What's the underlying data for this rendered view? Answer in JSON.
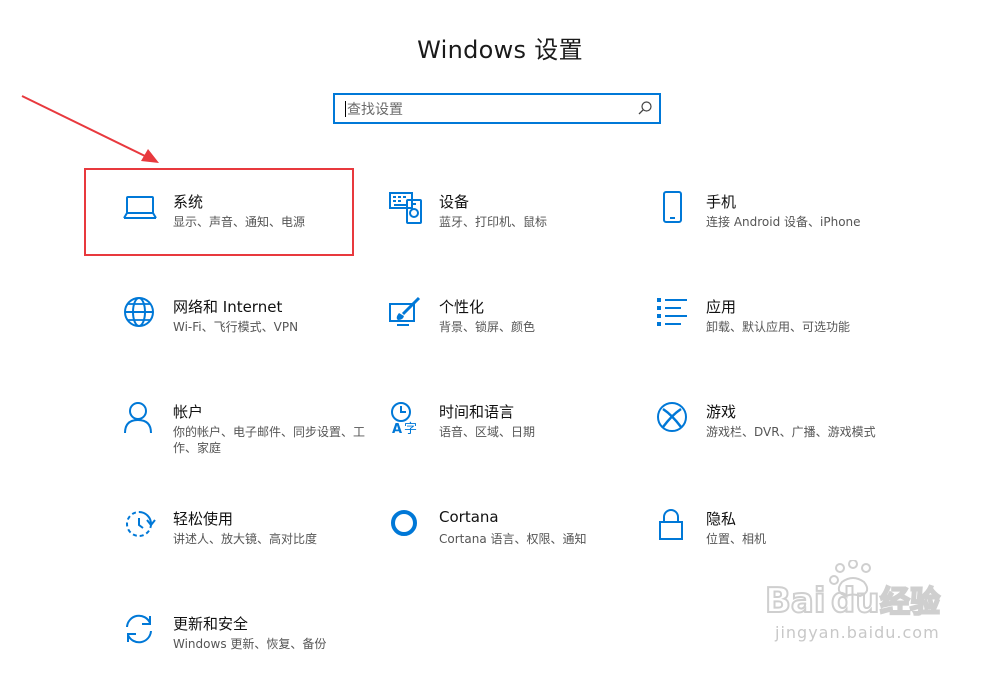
{
  "window": {
    "title": "Windows 设置"
  },
  "search": {
    "placeholder": "查找设置"
  },
  "accent_color": "#0078d7",
  "highlight_color": "#e8393e",
  "tiles": [
    {
      "name": "系统",
      "desc": "显示、声音、通知、电源",
      "icon": "laptop-icon"
    },
    {
      "name": "设备",
      "desc": "蓝牙、打印机、鼠标",
      "icon": "keyboard-devices-icon"
    },
    {
      "name": "手机",
      "desc": "连接 Android 设备、iPhone",
      "icon": "phone-icon"
    },
    {
      "name": "网络和 Internet",
      "desc": "Wi-Fi、飞行模式、VPN",
      "icon": "globe-icon"
    },
    {
      "name": "个性化",
      "desc": "背景、锁屏、颜色",
      "icon": "paint-brush-icon"
    },
    {
      "name": "应用",
      "desc": "卸载、默认应用、可选功能",
      "icon": "apps-list-icon"
    },
    {
      "name": "帐户",
      "desc": "你的帐户、电子邮件、同步设置、工作、家庭",
      "icon": "person-icon"
    },
    {
      "name": "时间和语言",
      "desc": "语音、区域、日期",
      "icon": "time-language-icon"
    },
    {
      "name": "游戏",
      "desc": "游戏栏、DVR、广播、游戏模式",
      "icon": "xbox-icon"
    },
    {
      "name": "轻松使用",
      "desc": "讲述人、放大镜、高对比度",
      "icon": "ease-of-access-icon"
    },
    {
      "name": "Cortana",
      "desc": "Cortana 语言、权限、通知",
      "icon": "cortana-ring-icon"
    },
    {
      "name": "隐私",
      "desc": "位置、相机",
      "icon": "lock-icon"
    },
    {
      "name": "更新和安全",
      "desc": "Windows 更新、恢复、备份",
      "icon": "sync-icon"
    }
  ],
  "watermark": {
    "logo": "Baidu经验",
    "url": "jingyan.baidu.com"
  }
}
